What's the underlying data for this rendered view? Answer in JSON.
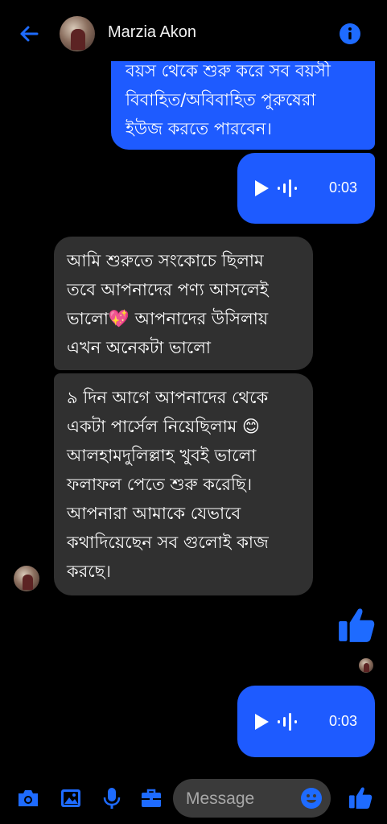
{
  "header": {
    "contact_name": "Marzia Akon"
  },
  "messages": {
    "outgoing_text_1": "বয়স থেকে শুরু করে সব বয়সী\nবিবাহিত/অবিবাহিত পুরুষেরা\nইউজ করতে পারবেন।",
    "audio_1_duration": "0:03",
    "incoming_text_1": "আমি শুরুতে সংকোচে ছিলাম\nতবে আপনাদের পণ্য আসলেই\nভালো💖 আপনাদের উসিলায়\nএখন অনেকটা ভালো",
    "incoming_text_2": "৯ দিন আগে আপনাদের থেকে\nএকটা পার্সেল নিয়েছিলাম 😊\nআলহামদুলিল্লাহ খুবই ভালো\nফলাফল পেতে শুরু করেছি।\nআপনারা আমাকে যেভাবে\nকথাদিয়েছেন সব গুলোই কাজ\nকরছে।",
    "audio_2_duration": "0:03"
  },
  "composer": {
    "placeholder": "Message"
  },
  "icons": {
    "back": "arrow-left-icon",
    "info": "info-icon",
    "camera": "camera-icon",
    "gallery": "image-icon",
    "mic": "microphone-icon",
    "toolbox": "briefcase-icon",
    "emoji": "smiley-icon",
    "like": "thumbs-up-icon"
  },
  "colors": {
    "accent": "#1e5bff",
    "incoming_bubble": "#303030",
    "background": "#000000"
  }
}
